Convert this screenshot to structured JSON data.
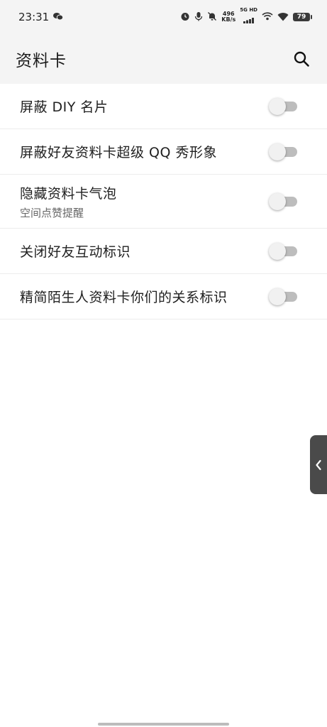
{
  "status_bar": {
    "time": "23:31",
    "net_speed_value": "496",
    "net_speed_unit": "KB/s",
    "signal_label": "5G HD",
    "battery": "79"
  },
  "app_bar": {
    "title": "资料卡",
    "search_icon": "search-icon"
  },
  "settings": [
    {
      "title": "屏蔽 DIY 名片",
      "enabled": false
    },
    {
      "title": "屏蔽好友资料卡超级 QQ 秀形象",
      "enabled": false
    },
    {
      "title": "隐藏资料卡气泡",
      "subtitle": "空间点赞提醒",
      "enabled": false
    },
    {
      "title": "关闭好友互动标识",
      "enabled": false
    },
    {
      "title": "精简陌生人资料卡你们的关系标识",
      "enabled": false
    }
  ],
  "colors": {
    "bar_background": "#f4f4f4",
    "switch_track_off": "#bdbdbd",
    "switch_thumb_off": "#f1f1f1"
  }
}
